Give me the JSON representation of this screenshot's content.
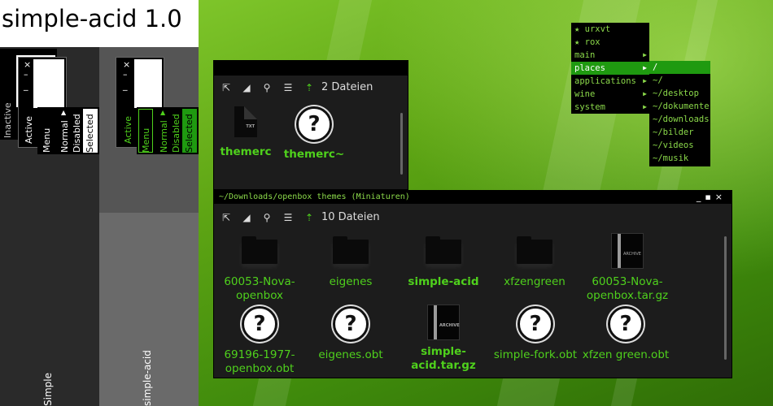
{
  "colors": {
    "accent": "#4fd11c",
    "menu_text": "#8bd94a",
    "menu_selected_bg": "#1f9a10",
    "window_bg": "#1c1c1c"
  },
  "preview": {
    "title": "simple-acid 1.0",
    "simple": {
      "name": "Simple",
      "inactive": "Inactive",
      "active": "Active",
      "menu": "Menu",
      "normal": "Normal",
      "disabled": "Disabled",
      "selected": "Selected"
    },
    "acid": {
      "name": "simple-acid",
      "active": "Active",
      "menu": "Menu",
      "normal": "Normal",
      "disabled": "Disabled",
      "selected": "Selected"
    }
  },
  "window1": {
    "count": "2 Dateien",
    "items": [
      {
        "label": "themerc",
        "icon": "text-file-icon",
        "bold": true
      },
      {
        "label": "themerc~",
        "icon": "unknown-file-icon",
        "bold": true
      }
    ]
  },
  "window2": {
    "title": "~/Downloads/openbox themes (Miniaturen)",
    "count": "10 Dateien",
    "items": [
      {
        "label": "60053-Nova-openbox",
        "icon": "folder-icon",
        "bold": false
      },
      {
        "label": "eigenes",
        "icon": "folder-icon",
        "bold": false
      },
      {
        "label": "simple-acid",
        "icon": "folder-icon",
        "bold": true
      },
      {
        "label": "xfzengreen",
        "icon": "folder-icon",
        "bold": false
      },
      {
        "label": "60053-Nova-openbox.tar.gz",
        "icon": "archive-icon",
        "bold": false
      },
      {
        "label": "69196-1977-openbox.obt",
        "icon": "unknown-file-icon",
        "bold": false
      },
      {
        "label": "eigenes.obt",
        "icon": "unknown-file-icon",
        "bold": false
      },
      {
        "label": "simple-acid.tar.gz",
        "icon": "archive-icon",
        "bold": true
      },
      {
        "label": "simple-fork.obt",
        "icon": "unknown-file-icon",
        "bold": false
      },
      {
        "label": "xfzen green.obt",
        "icon": "unknown-file-icon",
        "bold": false
      }
    ]
  },
  "menu": {
    "root": [
      "★ urxvt",
      "★ rox",
      "main",
      "places",
      "applications",
      "wine",
      "system"
    ],
    "submenu": [
      "/",
      "~/",
      "~/desktop",
      "~/dokumente",
      "~/downloads",
      "~/bilder",
      "~/videos",
      "~/musik"
    ]
  }
}
